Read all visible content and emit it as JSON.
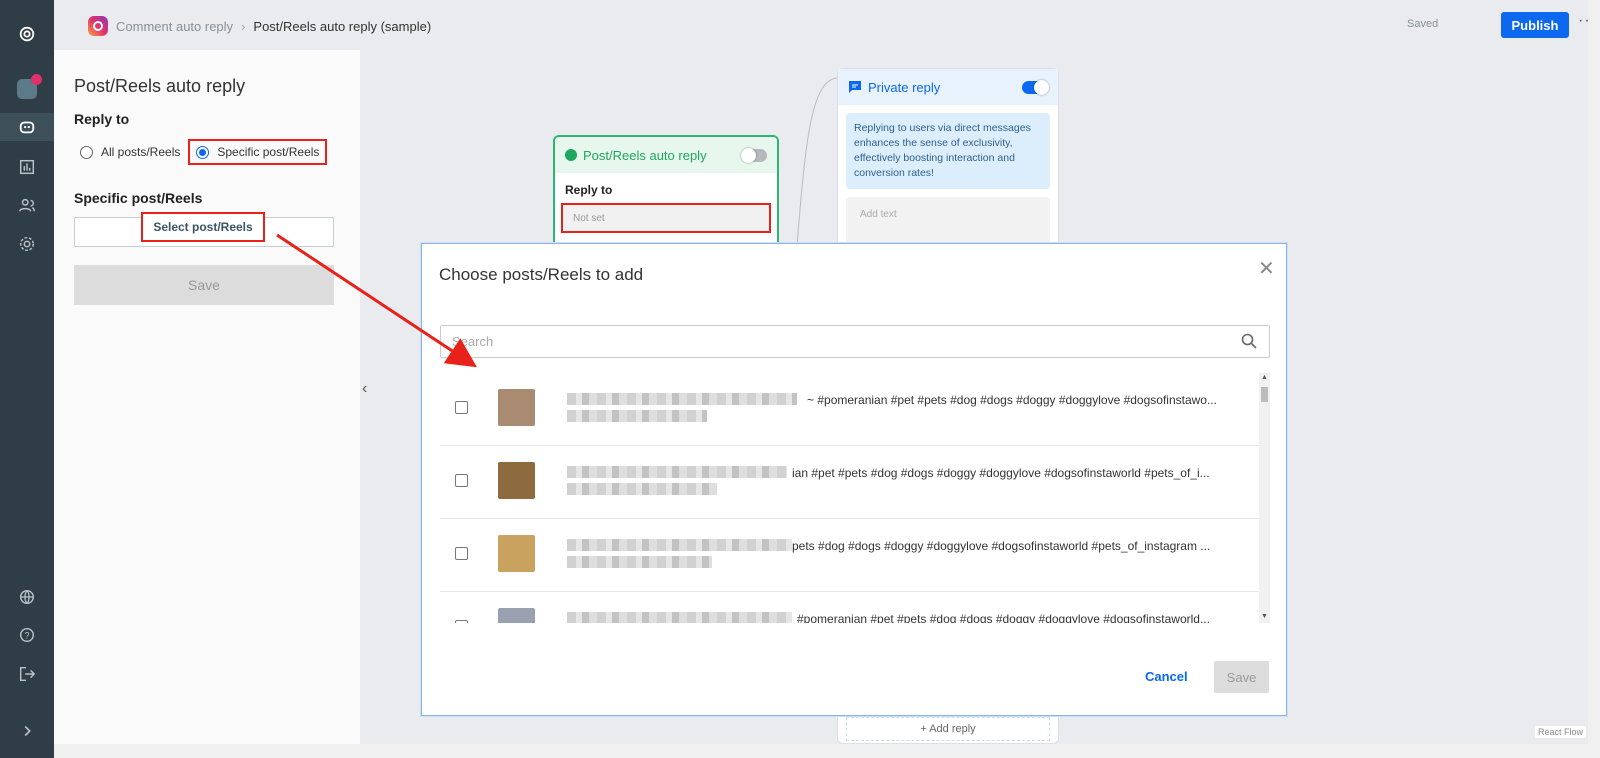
{
  "breadcrumb": {
    "parent": "Comment auto reply",
    "current": "Post/Reels auto reply (sample)"
  },
  "header": {
    "saved": "Saved",
    "publish": "Publish",
    "more": "···"
  },
  "panel": {
    "title": "Post/Reels auto reply",
    "reply_to_label": "Reply to",
    "options": [
      "All posts/Reels",
      "Specific post/Reels"
    ],
    "selected_option": "Specific post/Reels",
    "specific_label": "Specific post/Reels",
    "select_button": "Select post/Reels",
    "save": "Save"
  },
  "canvas": {
    "main_node": {
      "title": "Post/Reels auto reply",
      "reply_to": "Reply to",
      "value": "Not set",
      "enabled": false
    },
    "private_reply": {
      "title": "Private reply",
      "enabled": true,
      "info": "Replying to users via direct messages enhances the sense of exclusivity, effectively boosting interaction and conversion rates!",
      "add_text": "Add text",
      "add_reply": "+  Add reply"
    },
    "react_flow": "React Flow"
  },
  "modal": {
    "title": "Choose posts/Reels to add",
    "search_placeholder": "Search",
    "posts": [
      {
        "caption": "~ #pomeranian #pet #pets #dog #dogs #doggy #doggylove #dogsofinstawo...",
        "thumb_color": "#a98b72"
      },
      {
        "caption": "ian #pet #pets #dog #dogs #doggy #doggylove #dogsofinstaworld #pets_of_i...",
        "thumb_color": "#8e6b3f"
      },
      {
        "caption": "pets #dog #dogs #doggy #doggylove #dogsofinstaworld #pets_of_instagram ...",
        "thumb_color": "#c9a25f"
      },
      {
        "caption": "#pomeranian #pet #pets #dog #dogs #doggy #doggylove #dogsofinstaworld...",
        "thumb_color": "#9aa0b0"
      }
    ],
    "cancel": "Cancel",
    "save": "Save"
  },
  "colors": {
    "accent": "#0b68ef",
    "highlight": "#e8221b",
    "node_green": "#1ea75e"
  }
}
